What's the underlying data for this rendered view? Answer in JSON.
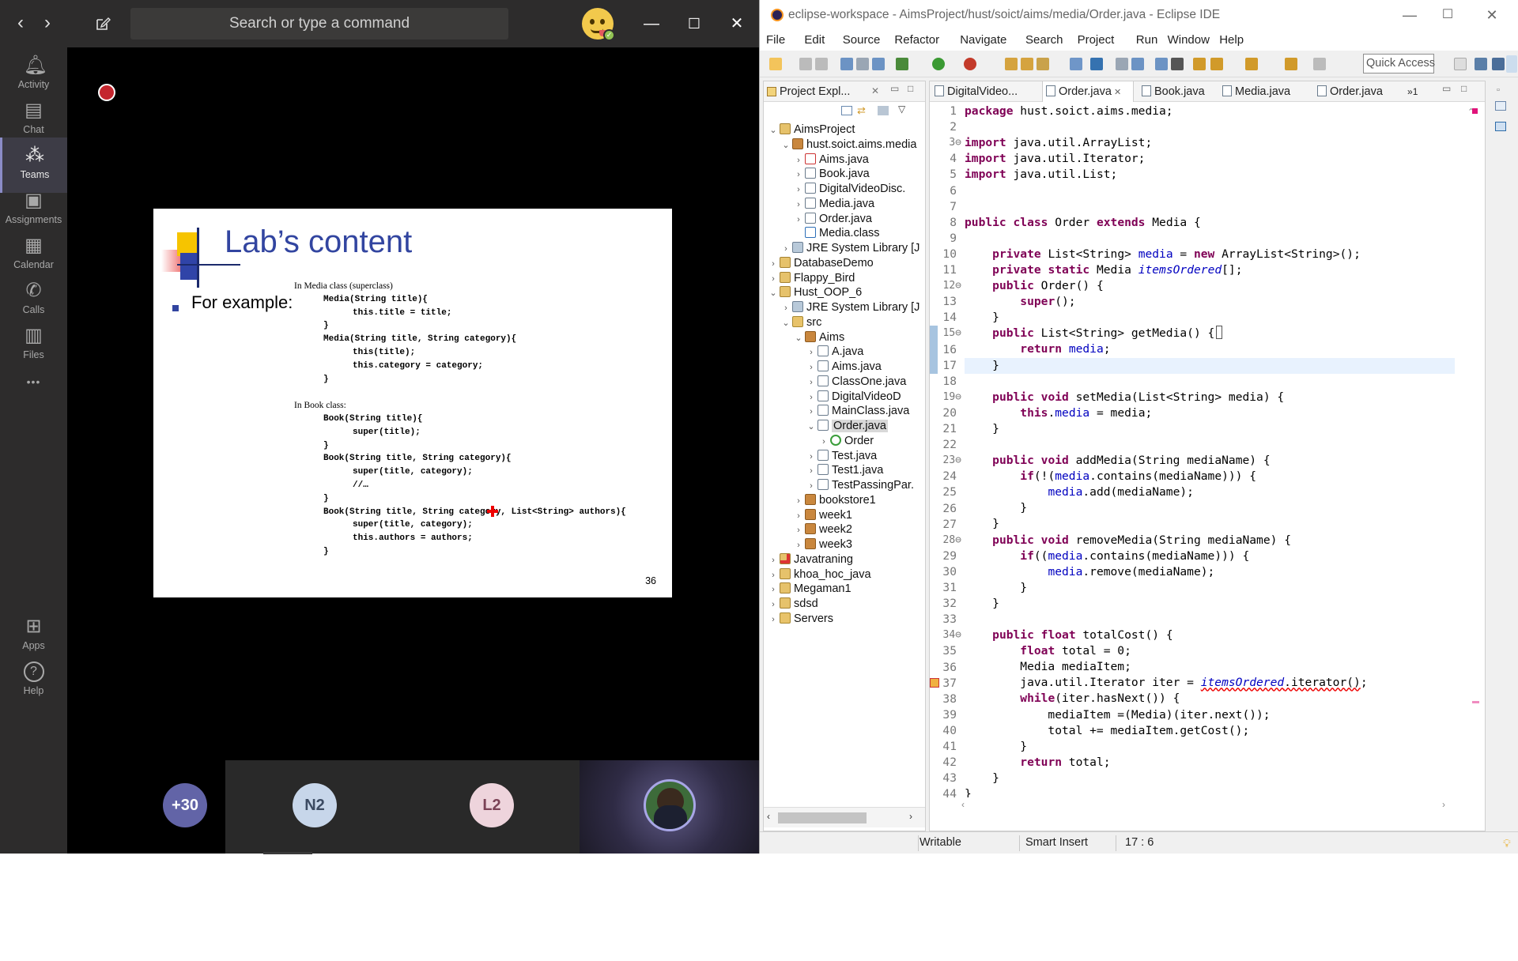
{
  "teams": {
    "search_placeholder": "Search or type a command",
    "rail": [
      {
        "label": "Activity",
        "icon": "bell-icon"
      },
      {
        "label": "Chat",
        "icon": "chat-icon"
      },
      {
        "label": "Teams",
        "icon": "teams-icon"
      },
      {
        "label": "Assignments",
        "icon": "briefcase-icon"
      },
      {
        "label": "Calendar",
        "icon": "calendar-icon"
      },
      {
        "label": "Calls",
        "icon": "phone-icon"
      },
      {
        "label": "Files",
        "icon": "file-icon"
      },
      {
        "label": "",
        "icon": "more-icon"
      },
      {
        "label": "Apps",
        "icon": "apps-icon"
      },
      {
        "label": "Help",
        "icon": "help-icon"
      }
    ],
    "active_rail": "Teams",
    "participants": [
      "+30",
      "N2",
      "L2"
    ],
    "slide": {
      "title": "Lab’s content",
      "bullet": "For example:",
      "page_number": "36",
      "code_lines": [
        {
          "t": "In Media class (superclass)",
          "k": "serif",
          "i": 0
        },
        {
          "t": "Media(String title){",
          "k": "mono",
          "i": 1
        },
        {
          "t": "this.title = title;",
          "k": "mono",
          "i": 2
        },
        {
          "t": "}",
          "k": "mono",
          "i": 1
        },
        {
          "t": "Media(String title, String category){",
          "k": "mono",
          "i": 1
        },
        {
          "t": "this(title);",
          "k": "mono",
          "i": 2
        },
        {
          "t": "this.category = category;",
          "k": "mono",
          "i": 2
        },
        {
          "t": "}",
          "k": "mono",
          "i": 1
        },
        {
          "t": "",
          "k": "mono",
          "i": 0
        },
        {
          "t": "In Book class:",
          "k": "serif",
          "i": 0
        },
        {
          "t": "Book(String title){",
          "k": "mono",
          "i": 1
        },
        {
          "t": "super(title);",
          "k": "mono",
          "i": 2
        },
        {
          "t": "}",
          "k": "mono",
          "i": 1
        },
        {
          "t": "Book(String title, String category){",
          "k": "mono",
          "i": 1
        },
        {
          "t": "super(title, category);",
          "k": "mono",
          "i": 2
        },
        {
          "t": "//…",
          "k": "mono",
          "i": 2
        },
        {
          "t": "}",
          "k": "mono",
          "i": 1
        },
        {
          "t": "Book(String title, String category, List<String> authors){",
          "k": "mono",
          "i": 1
        },
        {
          "t": "super(title, category);",
          "k": "mono",
          "i": 2
        },
        {
          "t": "this.authors = authors;",
          "k": "mono",
          "i": 2
        },
        {
          "t": "}",
          "k": "mono",
          "i": 1
        }
      ]
    }
  },
  "eclipse": {
    "window_title": "eclipse-workspace - AimsProject/hust/soict/aims/media/Order.java - Eclipse IDE",
    "menu": [
      "File",
      "Edit",
      "Source",
      "Refactor",
      "Navigate",
      "Search",
      "Project",
      "Run",
      "Window",
      "Help"
    ],
    "quick_access": "Quick Access",
    "explorer_tab": "Project Expl...",
    "tree": [
      {
        "label": "AimsProject",
        "depth": 0,
        "arrow": "v",
        "icon": "project"
      },
      {
        "label": "hust.soict.aims.media",
        "depth": 1,
        "arrow": "v",
        "icon": "package"
      },
      {
        "label": "Aims.java",
        "depth": 2,
        "arrow": ">",
        "icon": "java-err"
      },
      {
        "label": "Book.java",
        "depth": 2,
        "arrow": ">",
        "icon": "java"
      },
      {
        "label": "DigitalVideoDisc.",
        "depth": 2,
        "arrow": ">",
        "icon": "java"
      },
      {
        "label": "Media.java",
        "depth": 2,
        "arrow": ">",
        "icon": "java"
      },
      {
        "label": "Order.java",
        "depth": 2,
        "arrow": ">",
        "icon": "java"
      },
      {
        "label": "Media.class",
        "depth": 2,
        "arrow": "",
        "icon": "class"
      },
      {
        "label": "JRE System Library [J",
        "depth": 1,
        "arrow": ">",
        "icon": "library"
      },
      {
        "label": "DatabaseDemo",
        "depth": 0,
        "arrow": ">",
        "icon": "project"
      },
      {
        "label": "Flappy_Bird",
        "depth": 0,
        "arrow": ">",
        "icon": "project"
      },
      {
        "label": "Hust_OOP_6",
        "depth": 0,
        "arrow": "v",
        "icon": "project"
      },
      {
        "label": "JRE System Library [J",
        "depth": 1,
        "arrow": ">",
        "icon": "library"
      },
      {
        "label": "src",
        "depth": 1,
        "arrow": "v",
        "icon": "folder"
      },
      {
        "label": "Aims",
        "depth": 2,
        "arrow": "v",
        "icon": "package"
      },
      {
        "label": "A.java",
        "depth": 3,
        "arrow": ">",
        "icon": "java"
      },
      {
        "label": "Aims.java",
        "depth": 3,
        "arrow": ">",
        "icon": "java"
      },
      {
        "label": "ClassOne.java",
        "depth": 3,
        "arrow": ">",
        "icon": "java"
      },
      {
        "label": "DigitalVideoD",
        "depth": 3,
        "arrow": ">",
        "icon": "java"
      },
      {
        "label": "MainClass.java",
        "depth": 3,
        "arrow": ">",
        "icon": "java"
      },
      {
        "label": "Order.java",
        "depth": 3,
        "arrow": "v",
        "icon": "java",
        "selected": true
      },
      {
        "label": "Order",
        "depth": 4,
        "arrow": ">",
        "icon": "classg"
      },
      {
        "label": "Test.java",
        "depth": 3,
        "arrow": ">",
        "icon": "java"
      },
      {
        "label": "Test1.java",
        "depth": 3,
        "arrow": ">",
        "icon": "java"
      },
      {
        "label": "TestPassingPar.",
        "depth": 3,
        "arrow": ">",
        "icon": "java"
      },
      {
        "label": "bookstore1",
        "depth": 2,
        "arrow": ">",
        "icon": "package"
      },
      {
        "label": "week1",
        "depth": 2,
        "arrow": ">",
        "icon": "package"
      },
      {
        "label": "week2",
        "depth": 2,
        "arrow": ">",
        "icon": "package"
      },
      {
        "label": "week3",
        "depth": 2,
        "arrow": ">",
        "icon": "package"
      },
      {
        "label": "Javatraning",
        "depth": 0,
        "arrow": ">",
        "icon": "project-err"
      },
      {
        "label": "khoa_hoc_java",
        "depth": 0,
        "arrow": ">",
        "icon": "project"
      },
      {
        "label": "Megaman1",
        "depth": 0,
        "arrow": ">",
        "icon": "project"
      },
      {
        "label": "sdsd",
        "depth": 0,
        "arrow": ">",
        "icon": "project"
      },
      {
        "label": "Servers",
        "depth": 0,
        "arrow": ">",
        "icon": "folder"
      }
    ],
    "editor_tabs": [
      {
        "label": "DigitalVideo..."
      },
      {
        "label": "Order.java",
        "active": true
      },
      {
        "label": "Book.java"
      },
      {
        "label": "Media.java"
      },
      {
        "label": "Order.java"
      }
    ],
    "overflow_tabs": "1",
    "code": [
      "[[kw:package]] hust.soict.aims.media;",
      "",
      "[[kw:import]] java.util.ArrayList;",
      "[[kw:import]] java.util.Iterator;",
      "[[kw:import]] java.util.List;",
      "",
      "",
      "[[kw:public]] [[kw:class]] Order [[kw:extends]] Media {",
      "",
      "    [[kw:private]] List<String> [[fd:media]] = [[kw:new]] ArrayList<String>();",
      "    [[kw:private]] [[kw:static]] Media [[fi:itemsOrdered]][];",
      "    [[kw:public]] Order() {",
      "        [[kw:super]]();",
      "    }",
      "    [[kw:public]] List<String> getMedia() {",
      "        [[kw:return]] [[fd:media]];",
      "    }",
      "",
      "    [[kw:public]] [[kw:void]] setMedia(List<String> media) {",
      "        [[kw:this]].[[fd:media]] = media;",
      "    }",
      "",
      "    [[kw:public]] [[kw:void]] addMedia(String mediaName) {",
      "        [[kw:if]](!([[fd:media]].contains(mediaName))) {",
      "            [[fd:media]].add(mediaName);",
      "        }",
      "    }",
      "    [[kw:public]] [[kw:void]] removeMedia(String mediaName) {",
      "        [[kw:if]](([[fd:media]].contains(mediaName))) {",
      "            [[fd:media]].remove(mediaName);",
      "        }",
      "    }",
      "",
      "    [[kw:public]] [[kw:float]] totalCost() {",
      "        [[kw:float]] total = 0;",
      "        Media mediaItem;",
      "        java.util.Iterator iter = [[err:itemsOrdered.iterator()]];",
      "        [[kw:while]](iter.hasNext()) {",
      "            mediaItem =(Media)(iter.next());",
      "            total += mediaItem.getCost();",
      "        }",
      "        [[kw:return]] total;",
      "    }",
      "}"
    ],
    "fold_lines": [
      3,
      12,
      15,
      19,
      23,
      28,
      34
    ],
    "current_line": 17,
    "status": {
      "writable": "Writable",
      "insert_mode": "Smart Insert",
      "position": "17 : 6"
    }
  }
}
